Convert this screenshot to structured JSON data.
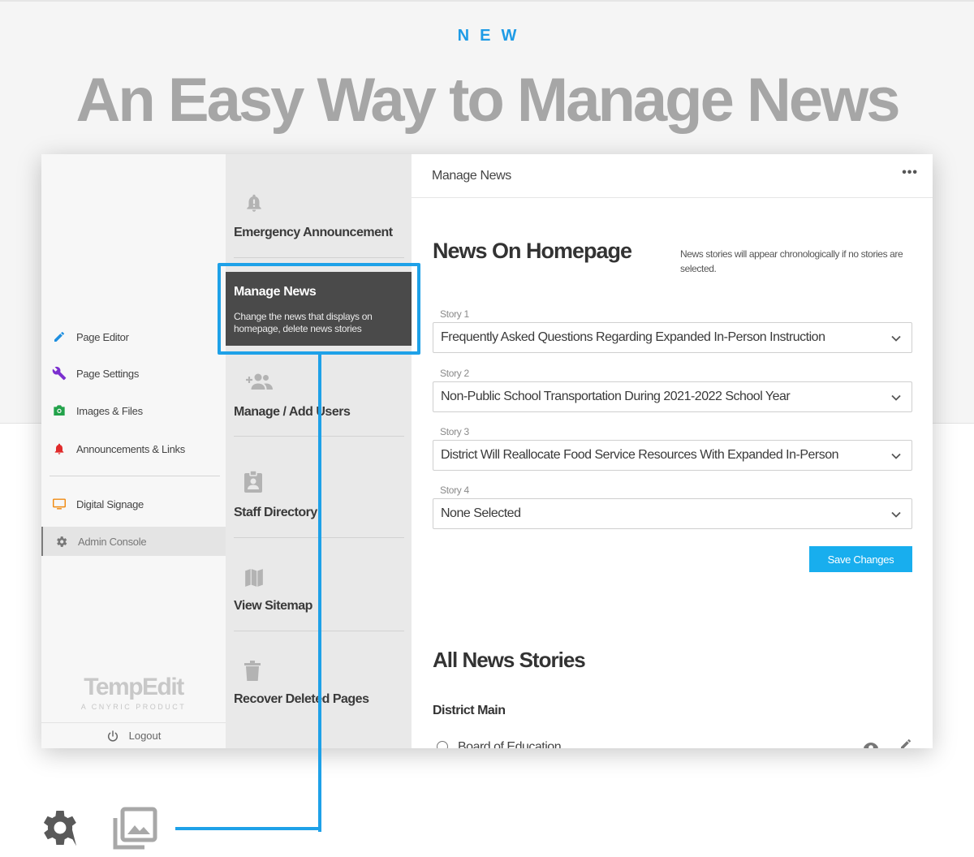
{
  "hero": {
    "eyebrow": "NEW",
    "headline": "An Easy Way to Manage News"
  },
  "sidebar": {
    "items": [
      {
        "label": "Page Editor",
        "icon": "pencil-icon",
        "color": "#1e8fe0"
      },
      {
        "label": "Page Settings",
        "icon": "wrench-icon",
        "color": "#7b2fcf"
      },
      {
        "label": "Images & Files",
        "icon": "camera-icon",
        "color": "#22a24a"
      },
      {
        "label": "Announcements & Links",
        "icon": "bell-icon",
        "color": "#e02b2b"
      },
      {
        "label": "Digital Signage",
        "icon": "monitor-icon",
        "color": "#f08a12"
      },
      {
        "label": "Admin Console",
        "icon": "gear-icon",
        "color": "#777777"
      }
    ],
    "brand": {
      "name": "TempEdit",
      "tagline": "A CNYRIC PRODUCT"
    },
    "logout_label": "Logout"
  },
  "menu": {
    "emergency": "Emergency Announcement",
    "manage_news": {
      "title": "Manage News",
      "description": "Change the news that displays on homepage, delete news stories"
    },
    "users": "Manage / Add Users",
    "staff": "Staff Directory",
    "sitemap": "View Sitemap",
    "recover": "Recover Deleted Pages"
  },
  "main": {
    "topbar_title": "Manage News",
    "more": "•••",
    "section_title": "News On Homepage",
    "note": "News stories will appear chronologically if no stories are selected.",
    "stories": [
      {
        "label": "Story 1",
        "value": "Frequently Asked Questions Regarding Expanded In-Person Instruction"
      },
      {
        "label": "Story 2",
        "value": "Non-Public School Transportation During 2021-2022 School Year"
      },
      {
        "label": "Story 3",
        "value": "District Will Reallocate Food Service Resources With Expanded In-Person"
      },
      {
        "label": "Story 4",
        "value": "None Selected"
      }
    ],
    "save_label": "Save Changes",
    "all_title": "All News Stories",
    "district": "District Main",
    "first_row": "Board of Education"
  },
  "colors": {
    "accent": "#1ea1e8",
    "save_button": "#18aeee",
    "headline": "#a6a6a6"
  }
}
